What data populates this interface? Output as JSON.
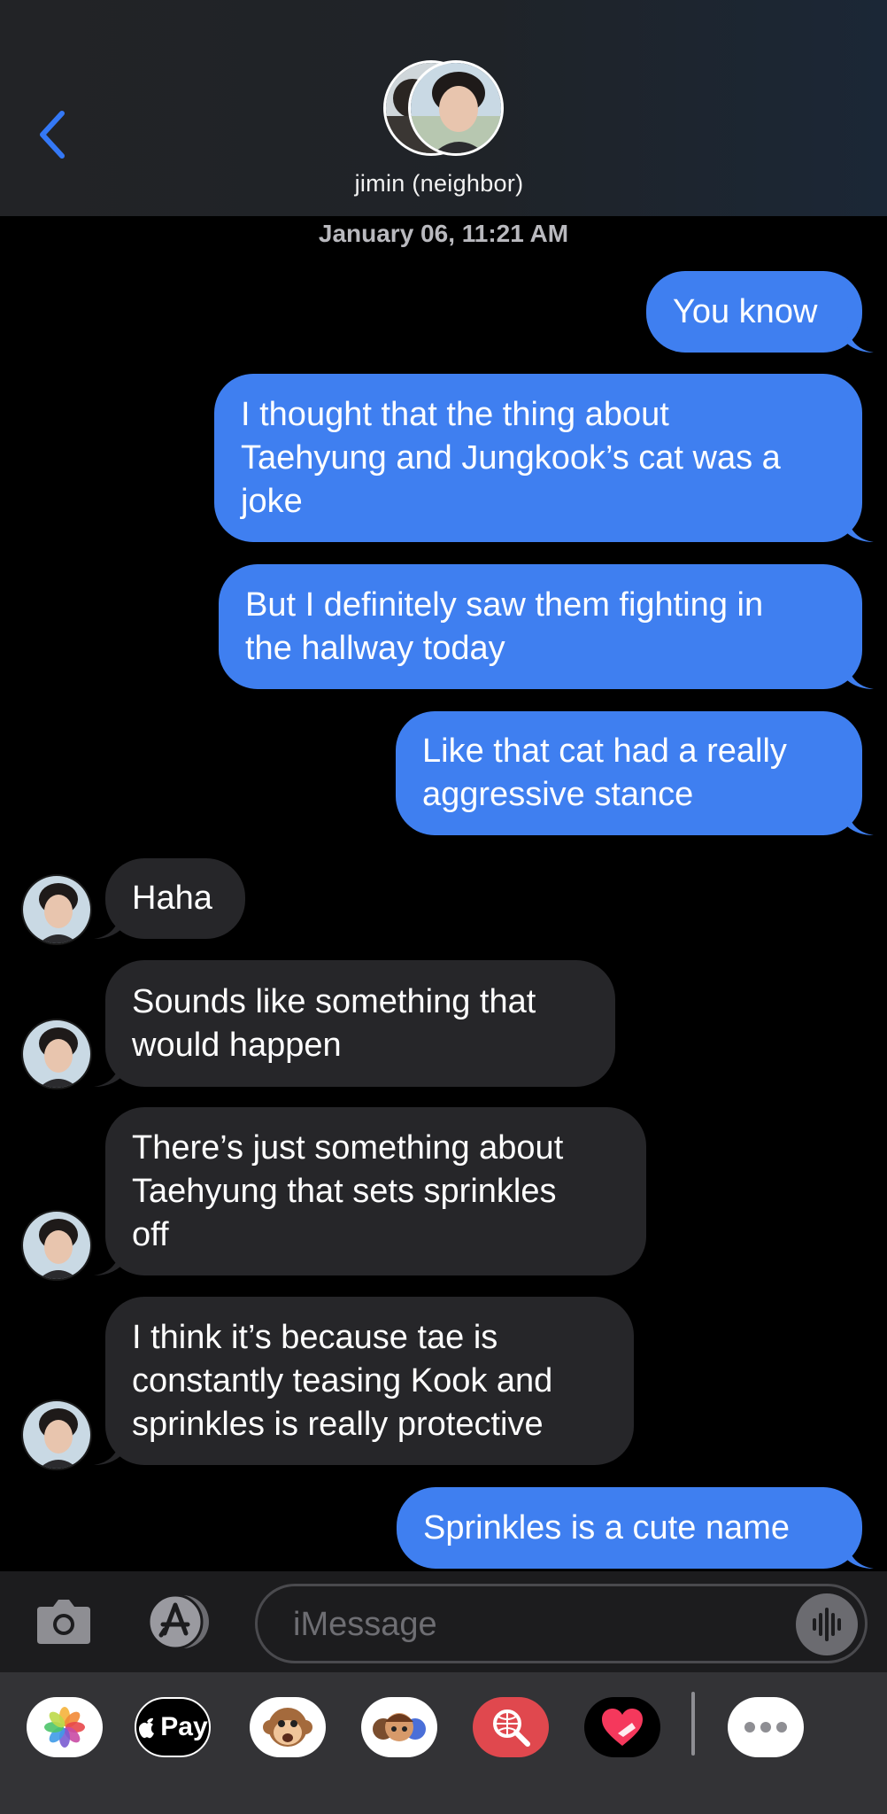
{
  "header": {
    "contact_name": "jimin (neighbor)"
  },
  "timestamp": "January 06, 11:21 AM",
  "messages": [
    {
      "from": "me",
      "text": "You know"
    },
    {
      "from": "me",
      "text": "I thought that the thing about\nTaehyung and Jungkook’s cat was a\njoke"
    },
    {
      "from": "me",
      "text": "But I definitely saw them fighting in\nthe hallway today"
    },
    {
      "from": "me",
      "text": "Like that cat had a really\naggressive stance"
    },
    {
      "from": "them",
      "text": "Haha"
    },
    {
      "from": "them",
      "text": "Sounds like something that\nwould happen"
    },
    {
      "from": "them",
      "text": "There’s just something about\nTaehyung that sets sprinkles\noff"
    },
    {
      "from": "them",
      "text": "I think it’s because tae is\nconstantly teasing Kook and\nsprinkles is really protective"
    },
    {
      "from": "me",
      "text": "Sprinkles is a cute name"
    }
  ],
  "compose": {
    "placeholder": "iMessage"
  },
  "apps": {
    "applepay_label": "Pay"
  },
  "colors": {
    "sent_bubble": "#3f7ff0",
    "received_bubble": "#262629",
    "accent": "#3478f6"
  }
}
